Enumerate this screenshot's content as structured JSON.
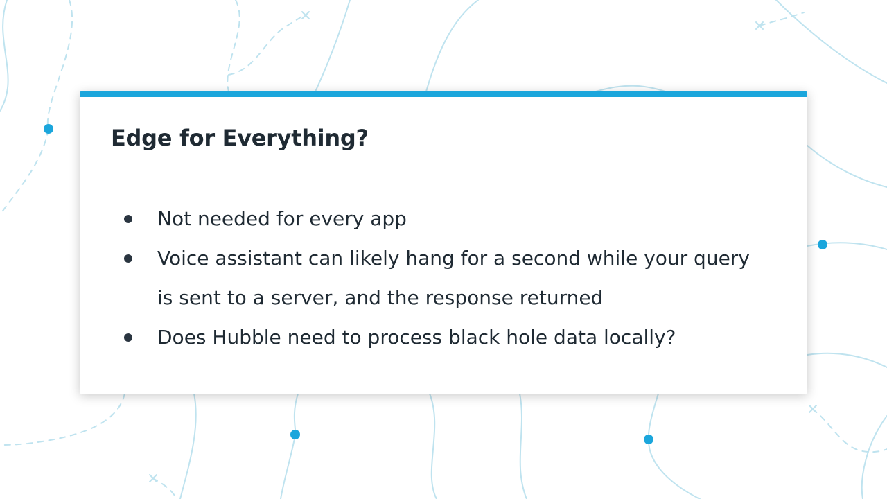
{
  "slide": {
    "title": "Edge for Everything?",
    "bullets": [
      "Not needed for every app",
      "Voice assistant can likely hang for a second while your query is sent to a server, and the response returned",
      "Does Hubble need to process black hole data locally?"
    ]
  },
  "colors": {
    "accent": "#1ba6dc",
    "text": "#1f2a33",
    "background_lines": "#bfe3ef"
  },
  "icons": {
    "bullet": "bullet-dot-icon",
    "background_node": "circle-node-icon",
    "background_cross": "x-mark-icon"
  }
}
